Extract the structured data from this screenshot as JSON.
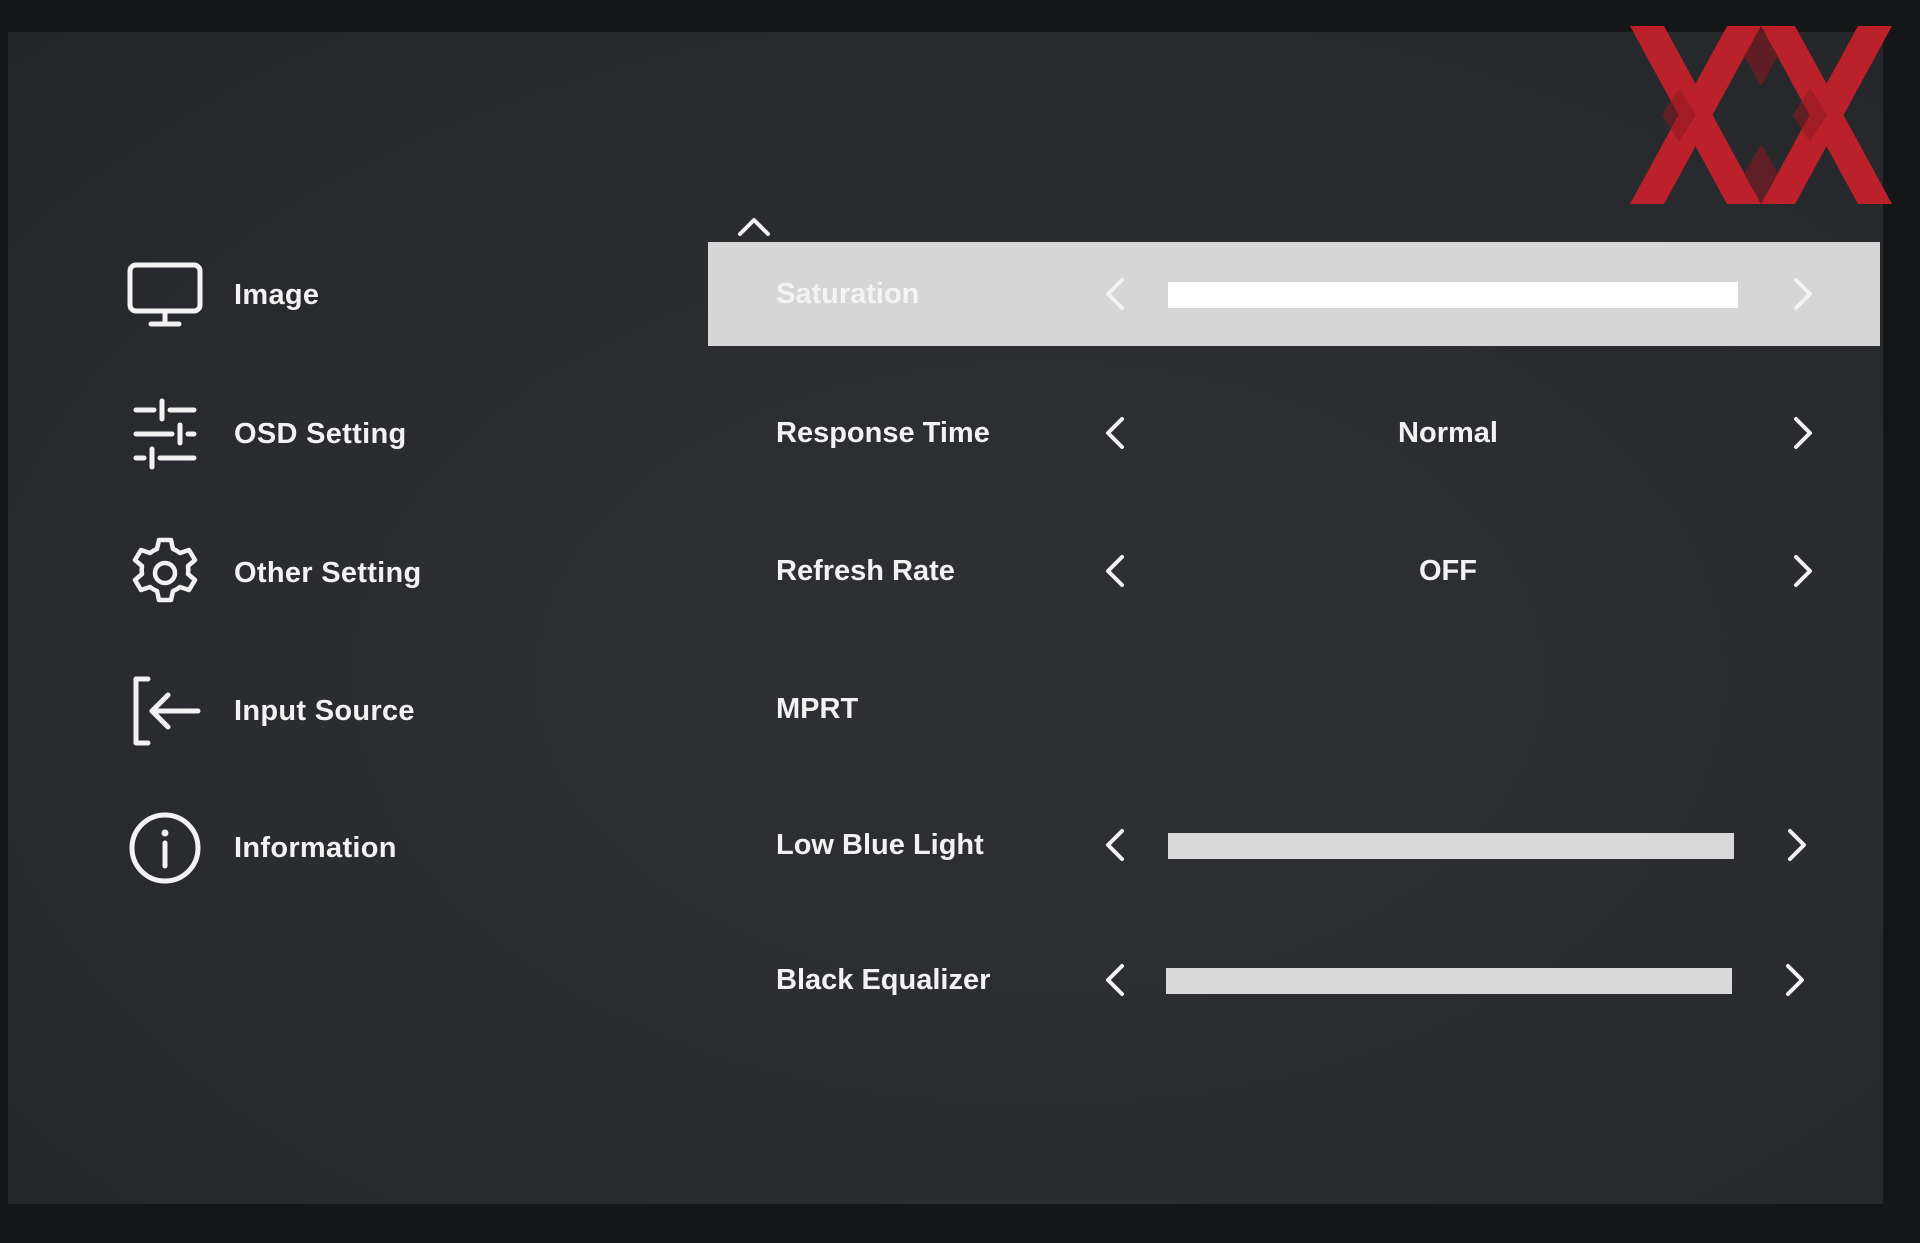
{
  "colors": {
    "screen_background": "#2a2c30",
    "selected_row": "#d6d6d6",
    "text": "#f2f2f2",
    "logo_red": "#c4212b"
  },
  "logo": {
    "name": "xx-logo",
    "text": "XX"
  },
  "menu": {
    "items": [
      {
        "label": "Image",
        "icon": "monitor-icon"
      },
      {
        "label": "OSD Setting",
        "icon": "sliders-icon"
      },
      {
        "label": "Other Setting",
        "icon": "gear-icon"
      },
      {
        "label": "Input Source",
        "icon": "input-arrow-icon"
      },
      {
        "label": "Information",
        "icon": "info-icon"
      }
    ]
  },
  "settings": {
    "scroll_up_icon": "chevron-up-icon",
    "rows": [
      {
        "label": "Saturation",
        "type": "slider",
        "level": 1.0,
        "selected": true
      },
      {
        "label": "Response Time",
        "type": "choice",
        "value": "Normal"
      },
      {
        "label": "Refresh Rate",
        "type": "choice",
        "value": "OFF"
      },
      {
        "label": "MPRT",
        "type": "label"
      },
      {
        "label": "Low Blue Light",
        "type": "slider",
        "level": 1.0
      },
      {
        "label": "Black Equalizer",
        "type": "slider",
        "level": 1.0
      }
    ]
  }
}
